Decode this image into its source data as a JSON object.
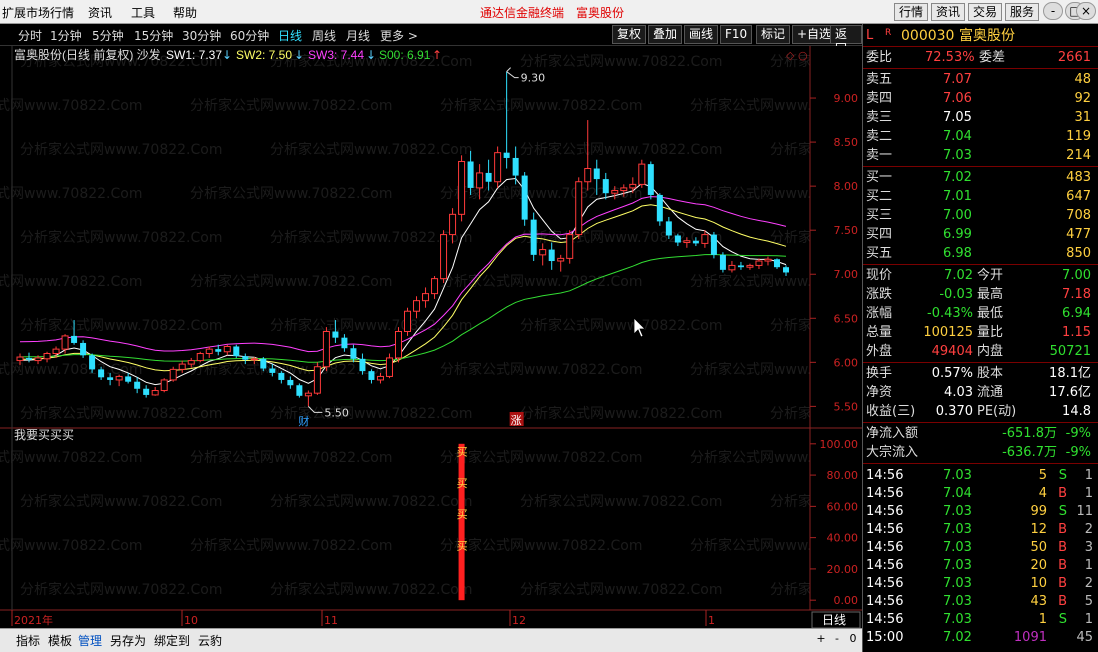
{
  "menubar": {
    "items": [
      "扩展市场行情",
      "资讯",
      "工具",
      "帮助"
    ],
    "title_left": "通达信金融终端",
    "title_right": "富奥股份",
    "right_buttons": [
      "行情",
      "资讯",
      "交易",
      "服务"
    ],
    "controls": [
      "-",
      "□",
      "×"
    ]
  },
  "periods": [
    "分时",
    "1分钟",
    "5分钟",
    "15分钟",
    "30分钟",
    "60分钟",
    "日线",
    "周线",
    "月线",
    "更多 >"
  ],
  "active_period": "日线",
  "toolbar": [
    "复权",
    "叠加",
    "画线",
    "F10",
    "标记",
    "+自选",
    "返回"
  ],
  "main_legend": {
    "stock": "富奥股份(日线 前复权) 沙发",
    "sw1_label": "SW1: 7.37",
    "sw2_label": "SW2: 7.50",
    "sw3_label": "SW3: 7.44",
    "s00_label": "S00: 6.91",
    "sw1_color": "#ffffff",
    "sw2_color": "#ffff66",
    "sw3_color": "#ff40ff",
    "s00_color": "#33dd33"
  },
  "sub_legend": "我要买买买",
  "annotations": {
    "high": "9.30",
    "low": "5.50",
    "cai": "财",
    "zhang": "涨",
    "buy": "买"
  },
  "x_labels": [
    "2021年",
    "10",
    "11",
    "12",
    "1"
  ],
  "axis_label": "日线",
  "chart_data": {
    "type": "candlestick",
    "price_axis": {
      "ticks": [
        9.0,
        8.5,
        8.0,
        7.5,
        7.0,
        6.5,
        6.0,
        5.5
      ],
      "ylim": [
        5.3,
        9.5
      ]
    },
    "indicator_axis": {
      "ticks": [
        100.0,
        80.0,
        60.0,
        40.0,
        20.0,
        0.0
      ],
      "ylim": [
        -5,
        105
      ]
    },
    "candles": [
      [
        6.02,
        6.1,
        5.97,
        6.06
      ],
      [
        6.05,
        6.11,
        6.0,
        6.03
      ],
      [
        6.02,
        6.08,
        5.98,
        6.05
      ],
      [
        6.04,
        6.12,
        6.0,
        6.1
      ],
      [
        6.1,
        6.18,
        6.05,
        6.15
      ],
      [
        6.15,
        6.32,
        6.1,
        6.3
      ],
      [
        6.3,
        6.48,
        6.2,
        6.22
      ],
      [
        6.22,
        6.25,
        6.05,
        6.08
      ],
      [
        6.08,
        6.1,
        5.88,
        5.92
      ],
      [
        5.92,
        5.95,
        5.8,
        5.83
      ],
      [
        5.83,
        5.88,
        5.74,
        5.8
      ],
      [
        5.8,
        5.86,
        5.73,
        5.84
      ],
      [
        5.84,
        5.88,
        5.76,
        5.78
      ],
      [
        5.78,
        5.83,
        5.65,
        5.7
      ],
      [
        5.7,
        5.74,
        5.6,
        5.63
      ],
      [
        5.63,
        5.72,
        5.62,
        5.68
      ],
      [
        5.68,
        5.82,
        5.66,
        5.8
      ],
      [
        5.8,
        5.95,
        5.78,
        5.92
      ],
      [
        5.92,
        6.02,
        5.88,
        5.98
      ],
      [
        5.98,
        6.05,
        5.94,
        6.02
      ],
      [
        6.02,
        6.12,
        6.0,
        6.1
      ],
      [
        6.1,
        6.18,
        6.05,
        6.15
      ],
      [
        6.15,
        6.2,
        6.08,
        6.12
      ],
      [
        6.12,
        6.2,
        6.08,
        6.18
      ],
      [
        6.18,
        6.2,
        6.05,
        6.07
      ],
      [
        6.07,
        6.1,
        5.98,
        6.03
      ],
      [
        6.03,
        6.06,
        5.98,
        6.04
      ],
      [
        6.04,
        6.06,
        5.9,
        5.93
      ],
      [
        5.93,
        5.98,
        5.84,
        5.88
      ],
      [
        5.88,
        5.9,
        5.76,
        5.8
      ],
      [
        5.8,
        5.84,
        5.7,
        5.74
      ],
      [
        5.74,
        5.76,
        5.6,
        5.62
      ],
      [
        5.62,
        5.68,
        5.5,
        5.65
      ],
      [
        5.65,
        6.0,
        5.63,
        5.95
      ],
      [
        5.95,
        6.4,
        5.9,
        6.35
      ],
      [
        6.35,
        6.48,
        6.22,
        6.28
      ],
      [
        6.28,
        6.32,
        6.12,
        6.16
      ],
      [
        6.16,
        6.2,
        6.0,
        6.04
      ],
      [
        6.04,
        6.1,
        5.86,
        5.9
      ],
      [
        5.9,
        5.92,
        5.76,
        5.8
      ],
      [
        5.8,
        5.88,
        5.76,
        5.84
      ],
      [
        5.84,
        6.1,
        5.82,
        6.05
      ],
      [
        6.05,
        6.4,
        6.0,
        6.35
      ],
      [
        6.35,
        6.62,
        6.3,
        6.58
      ],
      [
        6.58,
        6.75,
        6.5,
        6.7
      ],
      [
        6.7,
        6.85,
        6.62,
        6.78
      ],
      [
        6.78,
        6.98,
        6.72,
        6.95
      ],
      [
        6.95,
        7.5,
        6.9,
        7.45
      ],
      [
        7.45,
        7.75,
        7.35,
        7.68
      ],
      [
        7.68,
        8.35,
        7.6,
        8.28
      ],
      [
        8.28,
        8.4,
        7.9,
        7.98
      ],
      [
        7.98,
        8.25,
        7.85,
        8.15
      ],
      [
        8.15,
        8.3,
        7.95,
        8.05
      ],
      [
        8.05,
        8.45,
        7.98,
        8.38
      ],
      [
        8.38,
        9.3,
        8.2,
        8.32
      ],
      [
        8.32,
        8.45,
        8.02,
        8.12
      ],
      [
        8.12,
        8.16,
        7.55,
        7.62
      ],
      [
        7.62,
        7.7,
        7.15,
        7.22
      ],
      [
        7.22,
        7.35,
        7.1,
        7.28
      ],
      [
        7.28,
        7.36,
        7.05,
        7.15
      ],
      [
        7.15,
        7.22,
        7.03,
        7.18
      ],
      [
        7.18,
        7.5,
        7.12,
        7.45
      ],
      [
        7.45,
        8.1,
        7.4,
        8.05
      ],
      [
        8.05,
        8.75,
        7.95,
        8.2
      ],
      [
        8.2,
        8.3,
        7.9,
        8.08
      ],
      [
        8.08,
        8.15,
        7.85,
        7.92
      ],
      [
        7.92,
        8.0,
        7.85,
        7.95
      ],
      [
        7.95,
        8.02,
        7.88,
        7.98
      ],
      [
        7.98,
        8.1,
        7.92,
        8.02
      ],
      [
        8.02,
        8.3,
        7.98,
        8.25
      ],
      [
        8.25,
        8.28,
        7.85,
        7.9
      ],
      [
        7.9,
        7.92,
        7.55,
        7.6
      ],
      [
        7.6,
        7.65,
        7.4,
        7.44
      ],
      [
        7.44,
        7.46,
        7.32,
        7.36
      ],
      [
        7.36,
        7.42,
        7.3,
        7.38
      ],
      [
        7.38,
        7.42,
        7.32,
        7.35
      ],
      [
        7.35,
        7.5,
        7.3,
        7.45
      ],
      [
        7.45,
        7.48,
        7.18,
        7.22
      ],
      [
        7.22,
        7.25,
        7.02,
        7.05
      ],
      [
        7.05,
        7.15,
        7.02,
        7.1
      ],
      [
        7.1,
        7.14,
        7.05,
        7.08
      ],
      [
        7.08,
        7.12,
        7.05,
        7.1
      ],
      [
        7.1,
        7.18,
        7.06,
        7.15
      ],
      [
        7.15,
        7.2,
        7.1,
        7.17
      ],
      [
        7.17,
        7.18,
        7.06,
        7.08
      ],
      [
        7.08,
        7.1,
        6.98,
        7.02
      ]
    ],
    "buy_signal_bar": 49,
    "buy_signal_values": [
      95,
      75,
      55,
      35
    ]
  },
  "quote": {
    "code": "000030",
    "name": "富奥股份",
    "wb": {
      "label": "委比",
      "value": "72.53%",
      "label2": "委差",
      "value2": "2661"
    },
    "sell": [
      {
        "label": "卖五",
        "price": "7.07",
        "vol": "48"
      },
      {
        "label": "卖四",
        "price": "7.06",
        "vol": "92"
      },
      {
        "label": "卖三",
        "price": "7.05",
        "vol": "31"
      },
      {
        "label": "卖二",
        "price": "7.04",
        "vol": "119"
      },
      {
        "label": "卖一",
        "price": "7.03",
        "vol": "214"
      }
    ],
    "buy": [
      {
        "label": "买一",
        "price": "7.02",
        "vol": "483"
      },
      {
        "label": "买二",
        "price": "7.01",
        "vol": "647"
      },
      {
        "label": "买三",
        "price": "7.00",
        "vol": "708"
      },
      {
        "label": "买四",
        "price": "6.99",
        "vol": "477"
      },
      {
        "label": "买五",
        "price": "6.98",
        "vol": "850"
      }
    ],
    "stats": [
      {
        "l1": "现价",
        "v1": "7.02",
        "c1": "grn",
        "l2": "今开",
        "v2": "7.00",
        "c2": "grn"
      },
      {
        "l1": "涨跌",
        "v1": "-0.03",
        "c1": "grn",
        "l2": "最高",
        "v2": "7.18",
        "c2": "red"
      },
      {
        "l1": "涨幅",
        "v1": "-0.43%",
        "c1": "grn",
        "l2": "最低",
        "v2": "6.94",
        "c2": "grn"
      },
      {
        "l1": "总量",
        "v1": "100125",
        "c1": "yel",
        "l2": "量比",
        "v2": "1.15",
        "c2": "red"
      },
      {
        "l1": "外盘",
        "v1": "49404",
        "c1": "red",
        "l2": "内盘",
        "v2": "50721",
        "c2": "grn"
      }
    ],
    "stats2": [
      {
        "l1": "换手",
        "v1": "0.57%",
        "l2": "股本",
        "v2": "18.1亿"
      },
      {
        "l1": "净资",
        "v1": "4.03",
        "l2": "流通",
        "v2": "17.6亿"
      },
      {
        "l1": "收益(三)",
        "v1": "0.370",
        "l2": "PE(动)",
        "v2": "14.8"
      }
    ],
    "flows": [
      {
        "label": "净流入额",
        "value": "-651.8万",
        "pct": "-9%"
      },
      {
        "label": "大宗流入",
        "value": "-636.7万",
        "pct": "-9%"
      }
    ],
    "ticks": [
      {
        "t": "14:56",
        "p": "7.03",
        "v": "5",
        "bs": "S",
        "n": "1"
      },
      {
        "t": "14:56",
        "p": "7.04",
        "v": "4",
        "bs": "B",
        "n": "1"
      },
      {
        "t": "14:56",
        "p": "7.03",
        "v": "99",
        "bs": "S",
        "n": "11"
      },
      {
        "t": "14:56",
        "p": "7.03",
        "v": "12",
        "bs": "B",
        "n": "2"
      },
      {
        "t": "14:56",
        "p": "7.03",
        "v": "50",
        "bs": "B",
        "n": "3"
      },
      {
        "t": "14:56",
        "p": "7.03",
        "v": "20",
        "bs": "B",
        "n": "1"
      },
      {
        "t": "14:56",
        "p": "7.03",
        "v": "10",
        "bs": "B",
        "n": "2"
      },
      {
        "t": "14:56",
        "p": "7.03",
        "v": "43",
        "bs": "B",
        "n": "5"
      },
      {
        "t": "14:56",
        "p": "7.03",
        "v": "1",
        "bs": "S",
        "n": "1"
      },
      {
        "t": "15:00",
        "p": "7.02",
        "v": "1091",
        "bs": "",
        "n": "45"
      }
    ]
  },
  "bottom_tabs": [
    "指标",
    "模板",
    "管理",
    "另存为",
    "绑定到",
    "云豹"
  ],
  "active_bottom_tab": "管理",
  "bottom_minis": [
    "+",
    "-",
    "0"
  ],
  "watermark": "分析家公式网www.70822.Com"
}
